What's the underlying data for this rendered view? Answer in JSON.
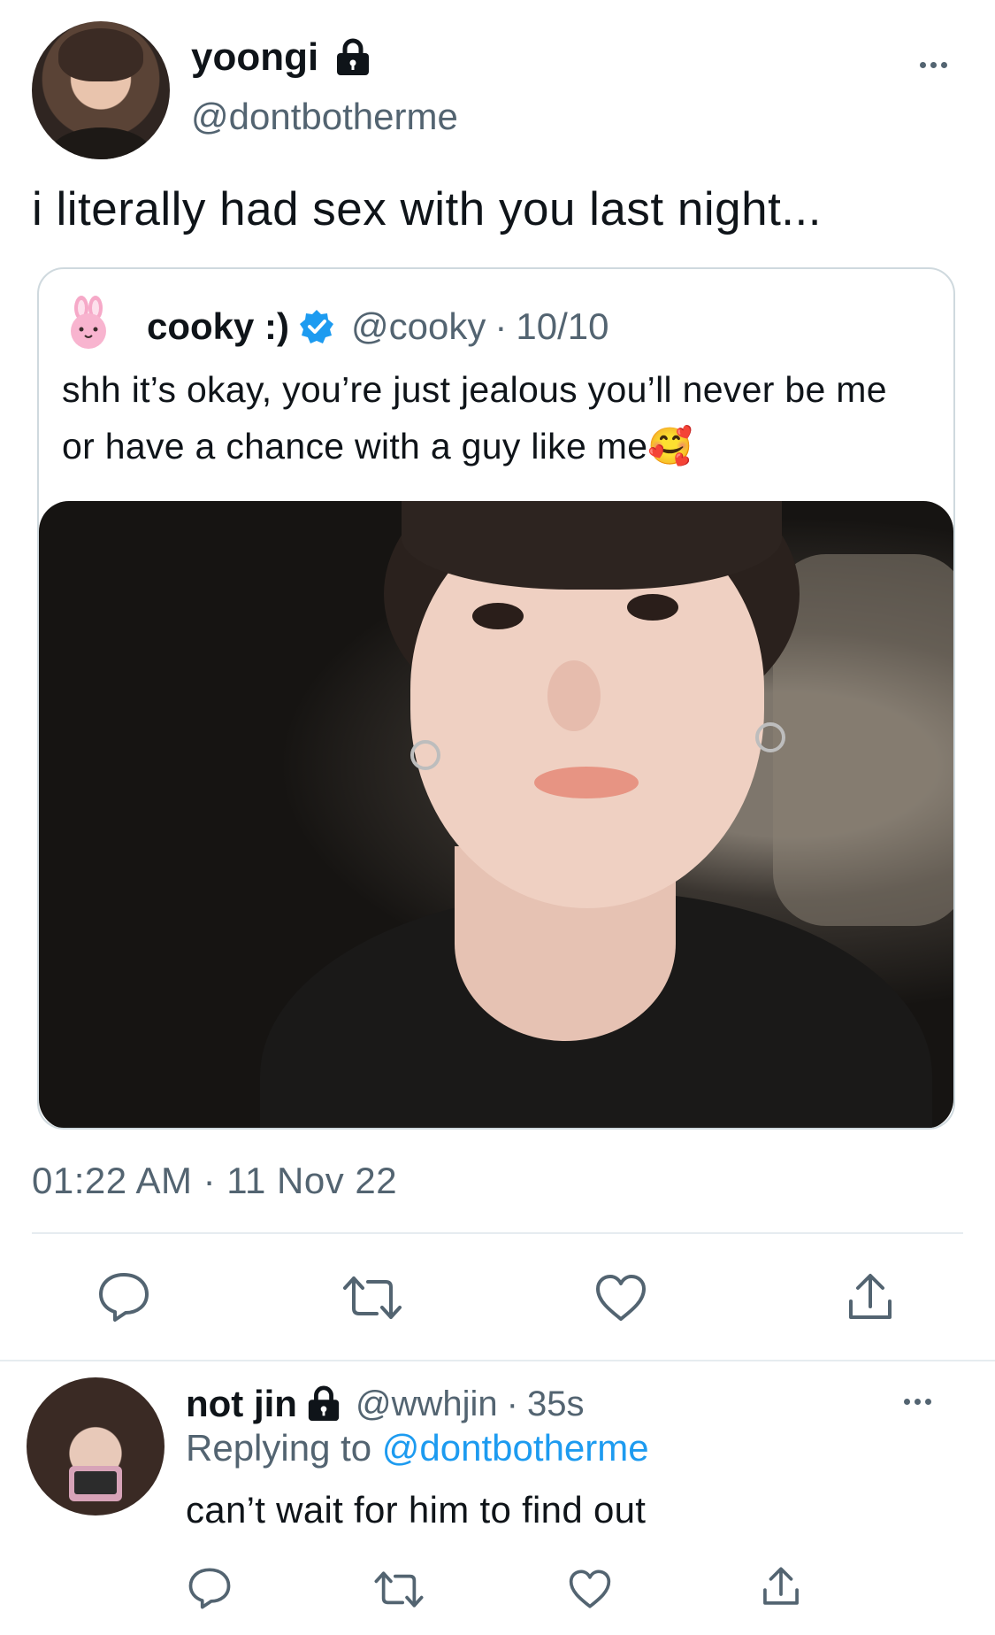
{
  "main_tweet": {
    "display_name": "yoongi",
    "handle": "@dontbotherme",
    "text": "i literally had sex with you last night...",
    "timestamp": "01:22 AM · 11 Nov 22",
    "avatar_icon": "avatar-photo",
    "protected_icon": "lock-icon"
  },
  "quoted_tweet": {
    "display_name": "cooky :)",
    "handle": "@cooky",
    "sep": "·",
    "date": "10/10",
    "text": "shh it’s okay, you’re just jealous you’ll never be me or have a chance with a guy like me🥰",
    "avatar_icon": "bunny-icon",
    "verified_icon": "verified-badge-icon",
    "media_icon": "photo-media"
  },
  "actions": [
    "reply-icon",
    "retweet-icon",
    "like-icon",
    "share-icon"
  ],
  "reply": {
    "display_name": "not jin",
    "handle": "@wwhjin",
    "sep": "·",
    "time": "35s",
    "replying_label": "Replying to",
    "replying_handle": "@dontbotherme",
    "text": "can’t wait for him to find out"
  },
  "colors": {
    "accent": "#1d9bf0",
    "muted": "#536471",
    "text": "#0f1419",
    "divider": "#e6ecf0"
  }
}
